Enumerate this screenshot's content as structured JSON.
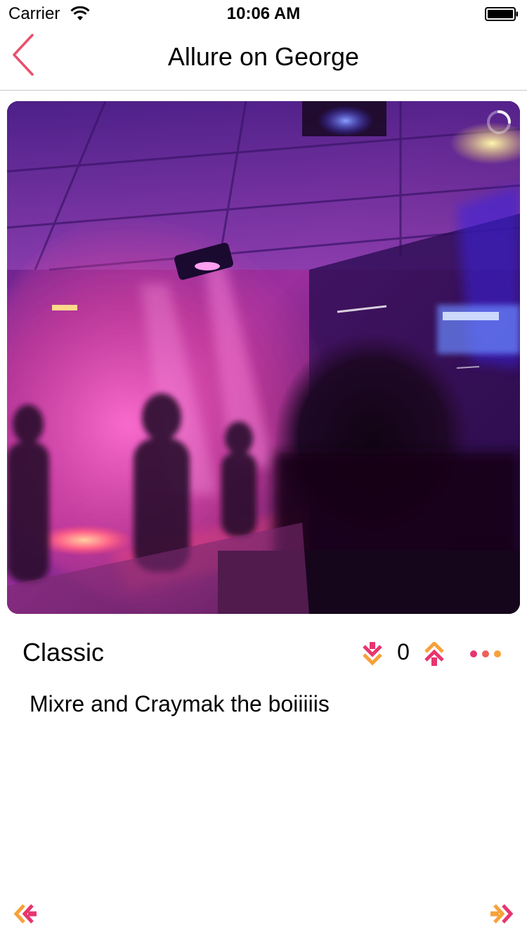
{
  "status_bar": {
    "carrier": "Carrier",
    "time": "10:06 AM"
  },
  "nav": {
    "title": "Allure on George",
    "back_icon": "chevron-left-icon"
  },
  "post": {
    "category": "Classic",
    "vote_count": "0",
    "caption": "Mixre and Craymak the boiiiiis",
    "downvote_icon": "double-chevron-down-icon",
    "upvote_icon": "double-chevron-up-icon",
    "more_icon": "more-dots-icon"
  },
  "footer": {
    "prev_icon": "double-chevron-left-icon",
    "next_icon": "double-chevron-right-icon"
  },
  "colors": {
    "accent_pink": "#e8356f",
    "accent_orange": "#f7a13a",
    "back_chevron": "#e8506e",
    "divider": "#c8c8cc"
  }
}
